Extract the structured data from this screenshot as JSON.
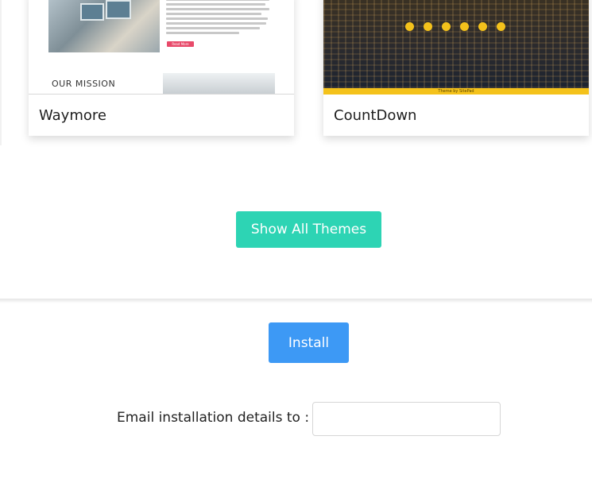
{
  "themes": [
    {
      "title": "Waymore",
      "thumb_heading": "OUR MISSION",
      "thumb_button": "Read More"
    },
    {
      "title": "CountDown",
      "thumb_footer": "Theme by SitePad"
    }
  ],
  "actions": {
    "show_all_label": "Show All Themes",
    "install_label": "Install"
  },
  "email": {
    "label": "Email installation details to :",
    "value": "",
    "placeholder": ""
  },
  "colors": {
    "show_all_bg": "#2dd4b4",
    "install_bg": "#3d99f5",
    "countdown_accent": "#f4c21b",
    "waymore_accent": "#e84a6a"
  }
}
